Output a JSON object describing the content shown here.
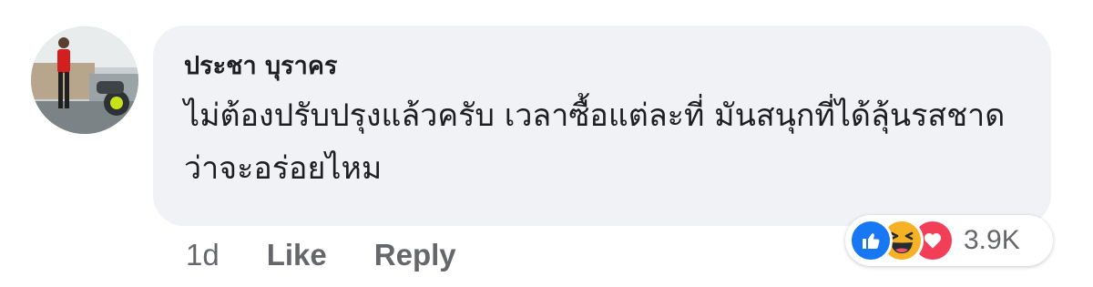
{
  "comment": {
    "author": "ประชา บุราคร",
    "text": "ไม่ต้องปรับปรุงแล้วครับ เวลาซื้อแต่ละที่ มันสนุกที่ได้ลุ้นรสชาดว่าจะอร่อยไหม",
    "timestamp": "1d",
    "like_label": "Like",
    "reply_label": "Reply",
    "reactions": {
      "icons": [
        "like-icon",
        "haha-icon",
        "love-icon"
      ],
      "count": "3.9K"
    }
  },
  "colors": {
    "bubble": "#f0f2f5",
    "text": "#1c1e21",
    "secondary": "#65676b",
    "like_blue": "#1877f2",
    "haha_yellow": "#f7b125",
    "love_red": "#f33e58"
  }
}
